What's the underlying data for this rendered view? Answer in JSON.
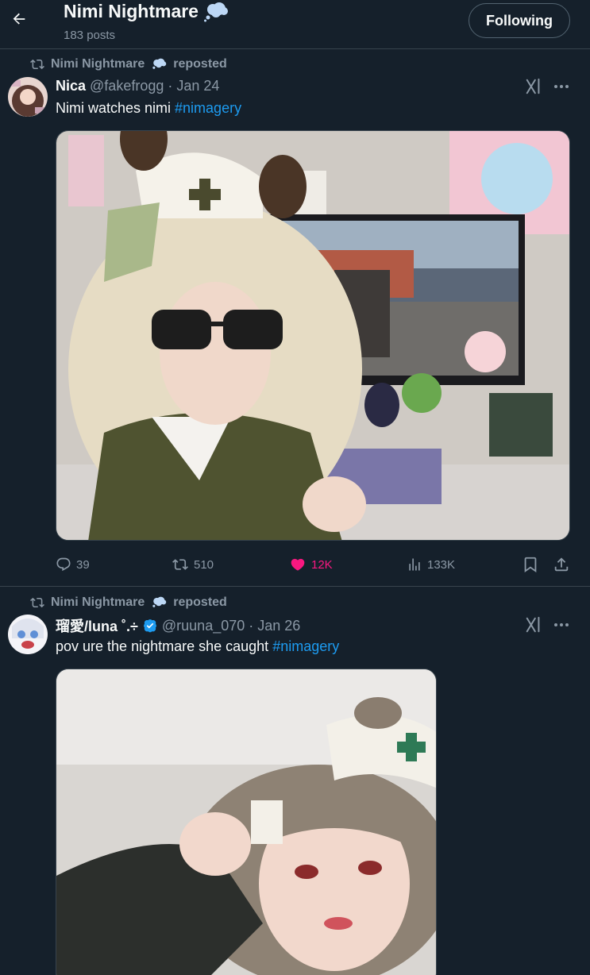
{
  "header": {
    "title": "Nimi Nightmare",
    "title_emoji": "thought-bubble-emoji",
    "post_count": "183 posts",
    "follow_button": "Following"
  },
  "posts": [
    {
      "repost_by": "Nimi Nightmare",
      "repost_label": "reposted",
      "author_name": "Nica",
      "author_handle": "@fakefrogg",
      "separator": "·",
      "date": "Jan 24",
      "text": "Nimi watches nimi ",
      "hashtag": "#nimagery",
      "stats": {
        "replies": "39",
        "reposts": "510",
        "likes": "12K",
        "views": "133K"
      }
    },
    {
      "repost_by": "Nimi Nightmare",
      "repost_label": "reposted",
      "author_name": "瑠愛/luna ˚.÷",
      "author_verified": true,
      "author_handle": "@ruuna_070",
      "separator": "·",
      "date": "Jan 26",
      "text": "pov ure the nightmare she caught ",
      "hashtag": "#nimagery"
    }
  ],
  "colors": {
    "background": "#15202b",
    "accent": "#1d9bf0",
    "like": "#f91880",
    "muted": "#8b98a5"
  }
}
